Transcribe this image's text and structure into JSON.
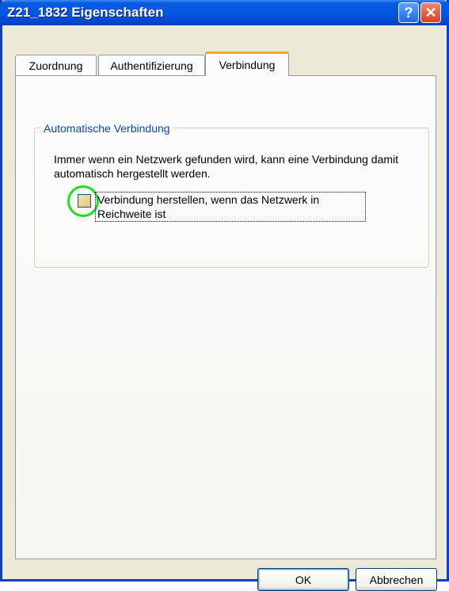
{
  "window": {
    "title": "Z21_1832 Eigenschaften",
    "help_glyph": "?",
    "close_glyph": "✕"
  },
  "tabs": [
    {
      "label": "Zuordnung",
      "active": false
    },
    {
      "label": "Authentifizierung",
      "active": false
    },
    {
      "label": "Verbindung",
      "active": true
    }
  ],
  "group": {
    "legend": "Automatische Verbindung",
    "description": "Immer wenn ein Netzwerk gefunden wird, kann eine Verbindung damit automatisch hergestellt werden.",
    "checkbox_label": "Verbindung herstellen, wenn das Netzwerk in Reichweite ist",
    "checkbox_checked": false
  },
  "buttons": {
    "ok": "OK",
    "cancel": "Abbrechen"
  },
  "colors": {
    "titlebar": "#0556e2",
    "active_tab_accent": "#f5a623",
    "group_legend": "#0046d5",
    "highlight_ring": "#22dd22"
  }
}
